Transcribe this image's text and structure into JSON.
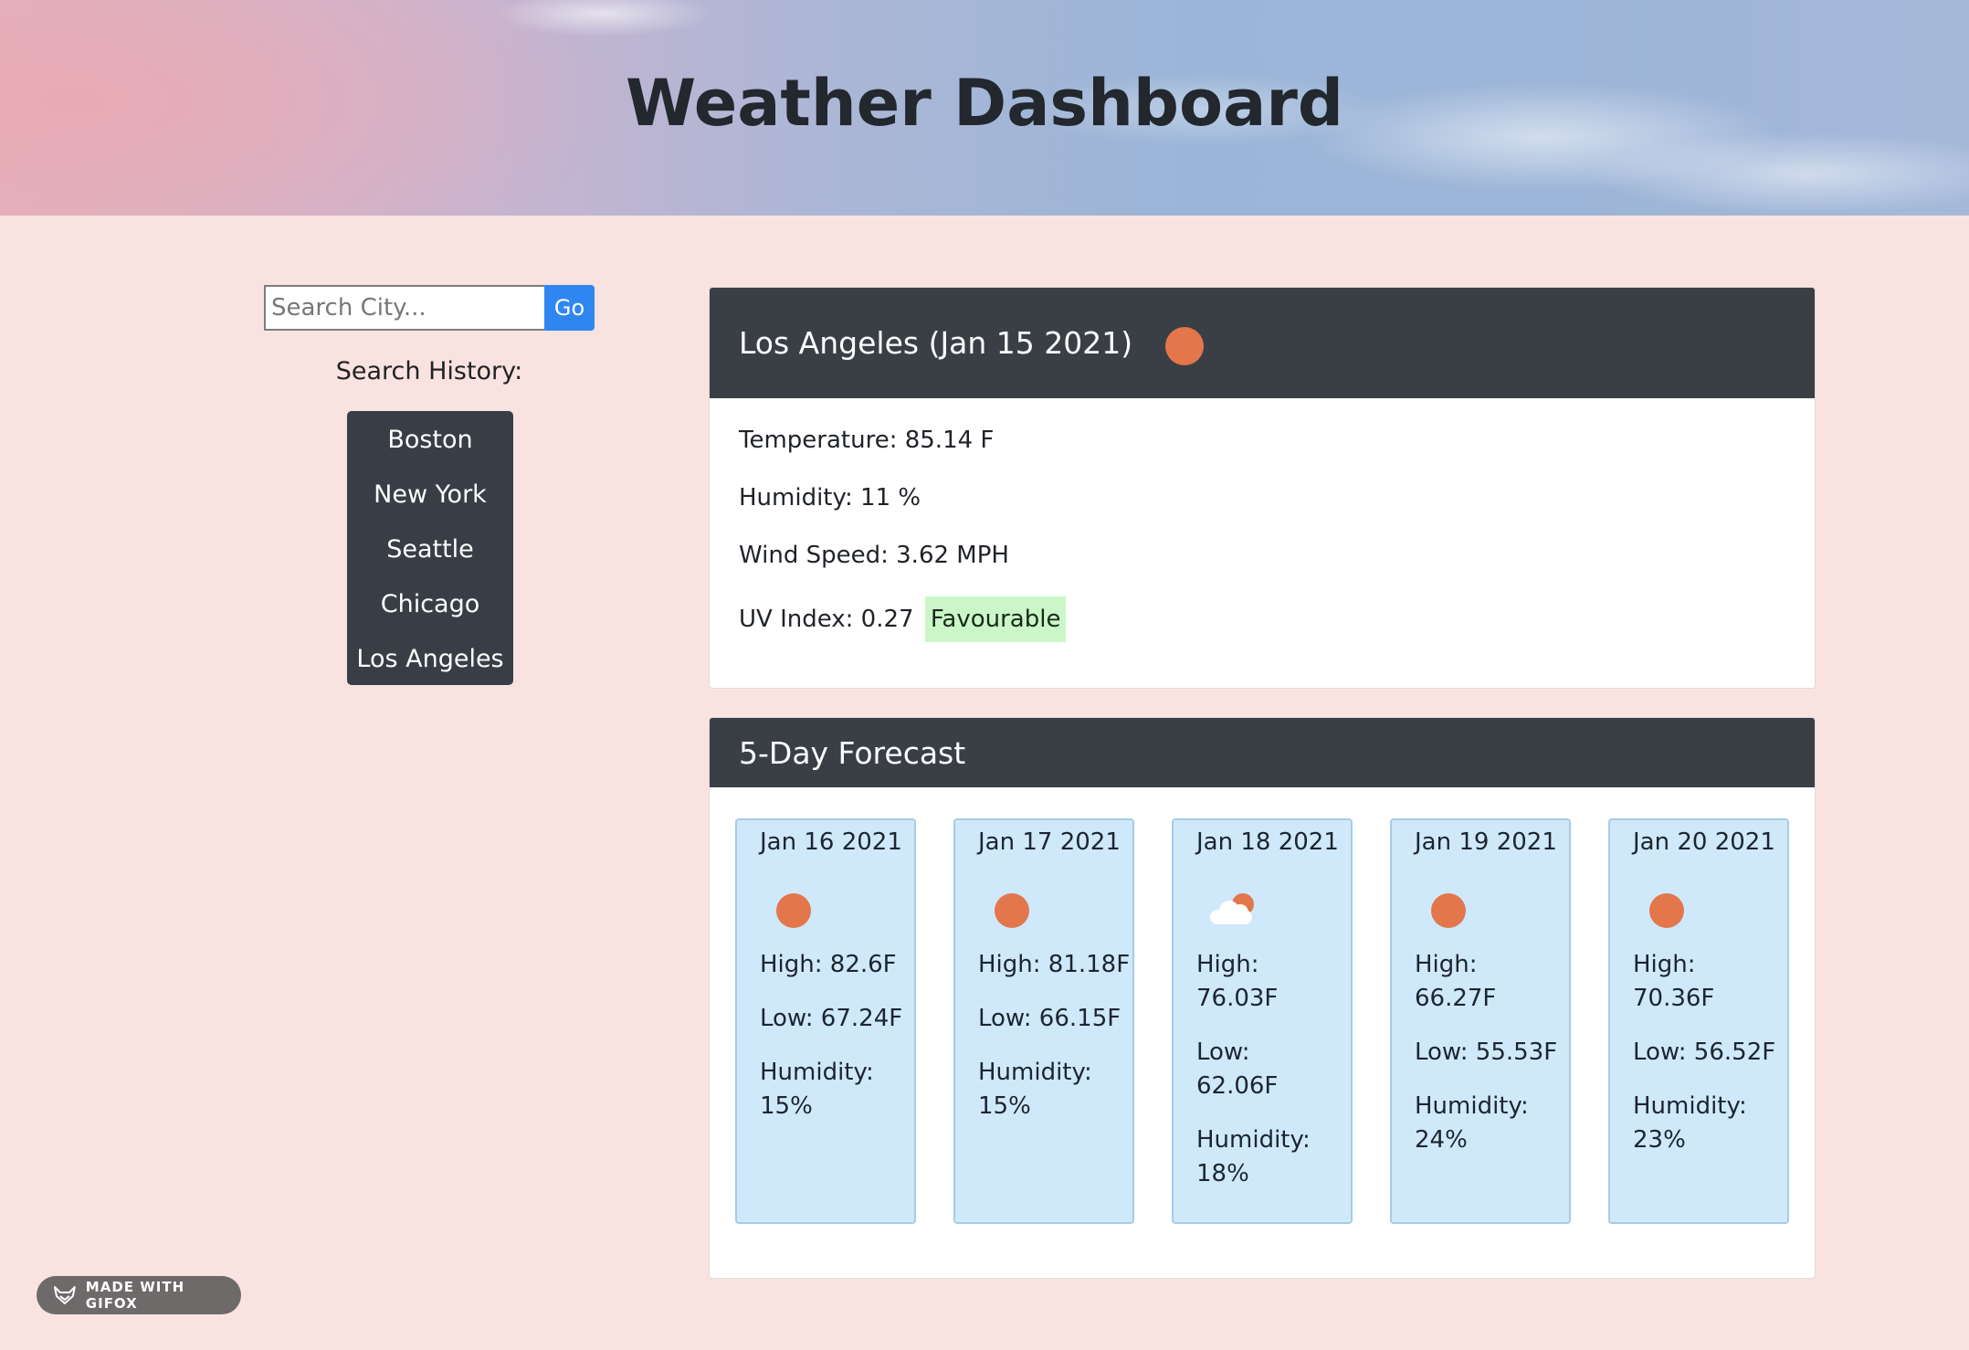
{
  "header": {
    "title": "Weather Dashboard"
  },
  "search": {
    "placeholder": "Search City...",
    "button_label": "Go"
  },
  "history": {
    "title": "Search History:",
    "items": [
      "Boston",
      "New York",
      "Seattle",
      "Chicago",
      "Los Angeles"
    ]
  },
  "current": {
    "heading": "Los Angeles (Jan 15 2021)",
    "icon": "sun-icon",
    "temperature": "Temperature: 85.14 F",
    "humidity": "Humidity: 11 %",
    "wind": "Wind Speed: 3.62 MPH",
    "uv_label": "UV Index: 0.27",
    "uv_status": "Favourable"
  },
  "forecast": {
    "title": "5-Day Forecast",
    "days": [
      {
        "date": "Jan 16 2021",
        "icon": "sun-icon",
        "high": "High: 82.6F",
        "low": "Low: 67.24F",
        "humidity_label": "Humidity:",
        "humidity": "15%"
      },
      {
        "date": "Jan 17 2021",
        "icon": "sun-icon",
        "high": "High: 81.18F",
        "low": "Low: 66.15F",
        "humidity_label": "Humidity:",
        "humidity": "15%"
      },
      {
        "date": "Jan 18 2021",
        "icon": "cloud-sun-icon",
        "high_label": "High:",
        "high": "76.03F",
        "low_label": "Low:",
        "low": "62.06F",
        "humidity_label": "Humidity:",
        "humidity": "18%"
      },
      {
        "date": "Jan 19 2021",
        "icon": "sun-icon",
        "high_label": "High:",
        "high": "66.27F",
        "low": "Low: 55.53F",
        "humidity_label": "Humidity:",
        "humidity": "24%"
      },
      {
        "date": "Jan 20 2021",
        "icon": "sun-icon",
        "high_label": "High:",
        "high": "70.36F",
        "low": "Low: 56.52F",
        "humidity_label": "Humidity:",
        "humidity": "23%"
      }
    ]
  },
  "watermark": {
    "text": "MADE WITH GIFOX",
    "icon": "fox-icon"
  },
  "colors": {
    "header_bar": "#3a3f46",
    "accent_button": "#2f86f0",
    "sun": "#e4764c",
    "forecast_card": "#cfe9fb",
    "uv_favourable": "#cbf7c8",
    "page_bg": "#f9e3e0"
  }
}
